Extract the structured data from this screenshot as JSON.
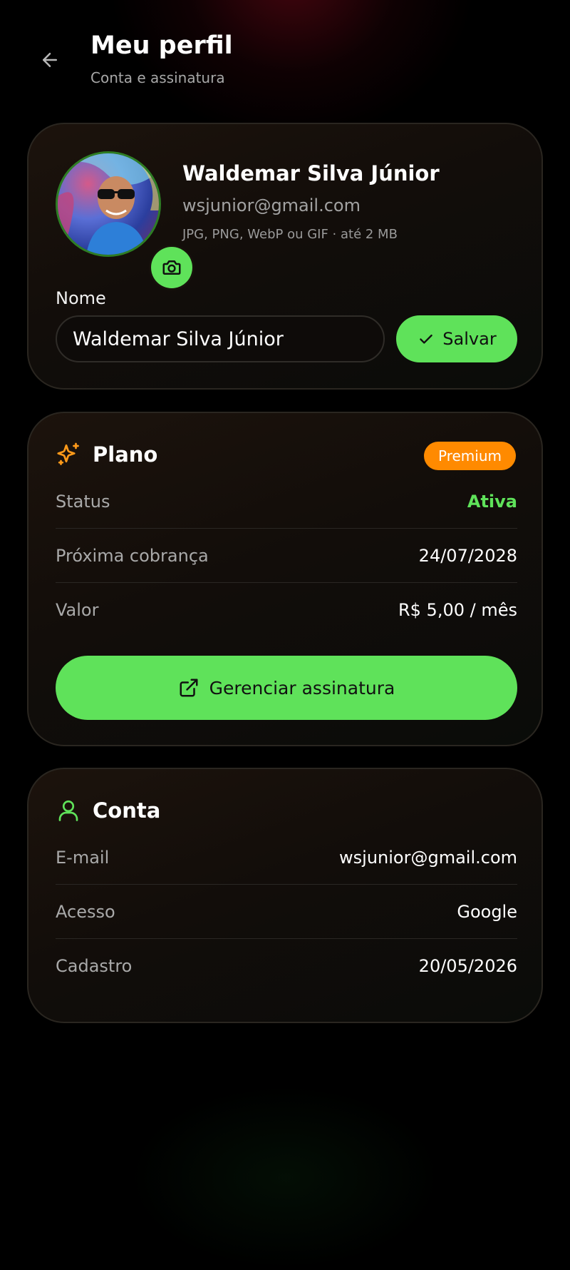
{
  "header": {
    "title": "Meu perfil",
    "subtitle": "Conta e assinatura"
  },
  "profile": {
    "name": "Waldemar Silva Júnior",
    "email": "wsjunior@gmail.com",
    "upload_hint": "JPG, PNG, WebP ou GIF · até 2 MB",
    "name_label": "Nome",
    "name_value": "Waldemar Silva Júnior",
    "save_label": "Salvar"
  },
  "plan": {
    "title": "Plano",
    "badge": "Premium",
    "rows": [
      {
        "label": "Status",
        "value": "Ativa"
      },
      {
        "label": "Próxima cobrança",
        "value": "24/07/2028"
      },
      {
        "label": "Valor",
        "value": "R$ 5,00 / mês"
      }
    ],
    "manage_label": "Gerenciar assinatura"
  },
  "account": {
    "title": "Conta",
    "rows": [
      {
        "label": "E-mail",
        "value": "wsjunior@gmail.com"
      },
      {
        "label": "Acesso",
        "value": "Google"
      },
      {
        "label": "Cadastro",
        "value": "20/05/2026"
      }
    ]
  },
  "colors": {
    "accent_green": "#5fe25a",
    "premium_orange": "#ff8a00",
    "background": "#000000"
  },
  "icons": {
    "back": "arrow-left-icon",
    "camera": "camera-icon",
    "save": "check-icon",
    "plan": "sparkles-icon",
    "manage": "external-link-icon",
    "account": "user-icon"
  }
}
